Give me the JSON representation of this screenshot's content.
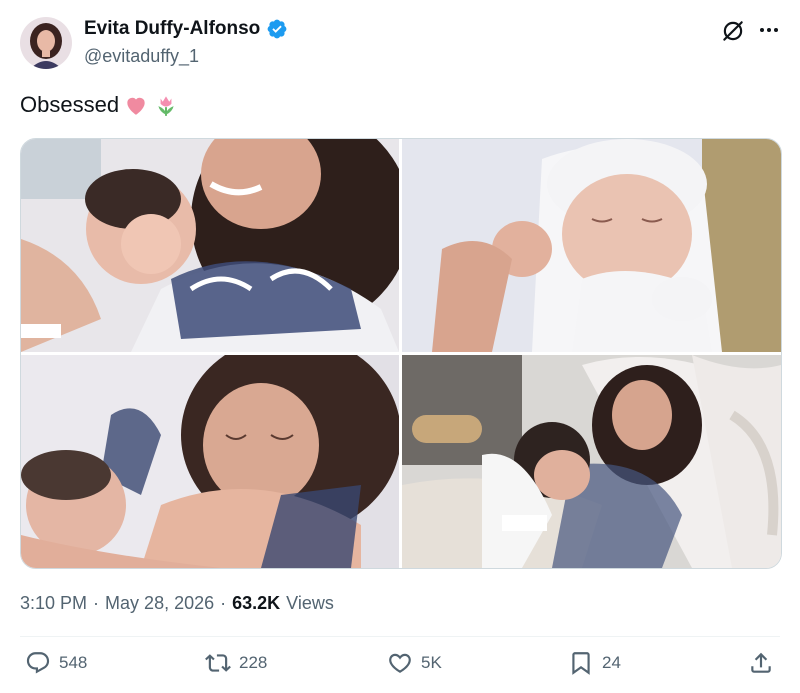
{
  "author": {
    "display_name": "Evita Duffy-Alfonso",
    "handle": "@evitaduffy_1",
    "verified": true
  },
  "icons": {
    "avatar": "avatar",
    "verified": "verified-badge-icon",
    "grok": "grok-icon",
    "more": "more-options-icon",
    "reply": "reply-icon",
    "retweet": "retweet-icon",
    "like": "heart-icon",
    "bookmark": "bookmark-icon",
    "share": "share-icon"
  },
  "tweet": {
    "text": "Obsessed",
    "emojis": [
      "pink-heart-emoji",
      "tulip-emoji"
    ]
  },
  "media": {
    "count": 4,
    "photos": [
      "photo-1",
      "photo-2",
      "photo-3",
      "photo-4"
    ]
  },
  "meta": {
    "time": "3:10 PM",
    "sep1": "·",
    "date": "May 28, 2026",
    "sep2": "·",
    "views_count": "63.2K",
    "views_label": "Views"
  },
  "actions": {
    "replies": "548",
    "retweets": "228",
    "likes": "5K",
    "bookmarks": "24"
  },
  "colors": {
    "verified": "#1d9bf0",
    "text_primary": "#0f1419",
    "text_secondary": "#536471",
    "border": "#cfd9de"
  }
}
